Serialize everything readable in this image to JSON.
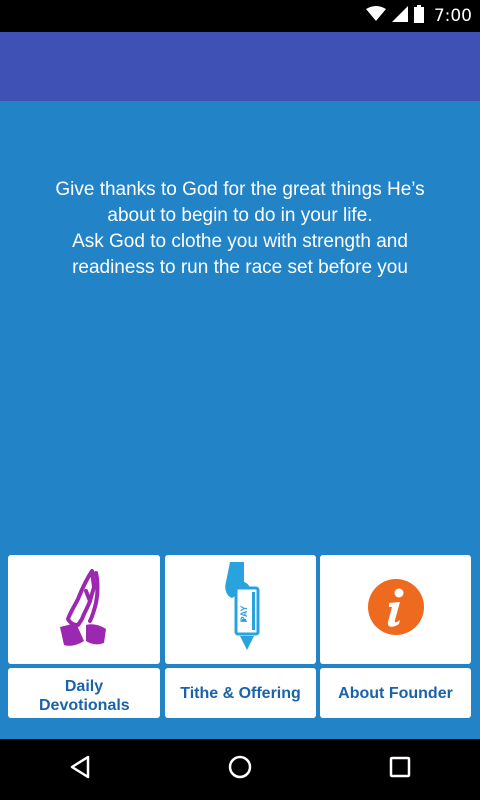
{
  "status_bar": {
    "time": "7:00"
  },
  "main": {
    "message_line1": "Give thanks to God for the great things He’s",
    "message_line2": "about to begin to do in your life.",
    "message_line3": "Ask God to clothe you with strength and",
    "message_line4": "readiness to run the race set before you"
  },
  "tiles": [
    {
      "label": "Daily Devotionals",
      "icon": "praying-hands-icon"
    },
    {
      "label": "Tithe & Offering",
      "icon": "pay-card-icon"
    },
    {
      "label": "About Founder",
      "icon": "info-icon"
    }
  ],
  "colors": {
    "status_bar": "#000000",
    "app_bar": "#3f51b5",
    "background": "#2383c7",
    "label_text": "#1b63a8",
    "praying_hands": "#9c27b0",
    "info_orange": "#ee6a1f",
    "pay_blue": "#29a3dd"
  }
}
